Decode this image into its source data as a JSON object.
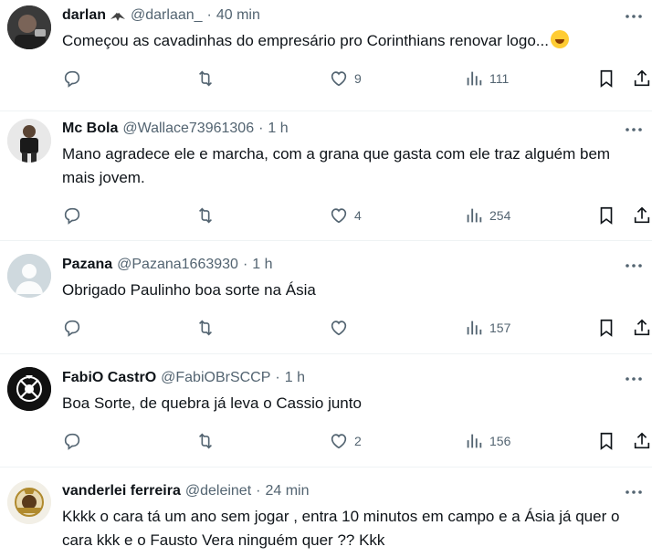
{
  "colors": {
    "text": "#0f1419",
    "muted": "#536471",
    "divider": "#eff3f4"
  },
  "icons": {
    "reply": "reply-icon",
    "retweet": "retweet-icon",
    "like": "heart-icon",
    "views": "views-icon",
    "bookmark": "bookmark-icon",
    "share": "share-icon",
    "more": "more-icon"
  },
  "tweets": [
    {
      "name": "darlan",
      "handle": "@darlaan_",
      "time": "40 min",
      "text": "Começou as cavadinhas do empresário pro Corinthians renovar logo...",
      "likes": "9",
      "views": "111"
    },
    {
      "name": "Mc Bola",
      "handle": "@Wallace73961306",
      "time": "1 h",
      "text": "Mano agradece ele e marcha, com a grana que gasta com ele traz alguém bem mais jovem.",
      "likes": "4",
      "views": "254"
    },
    {
      "name": "Pazana",
      "handle": "@Pazana1663930",
      "time": "1 h",
      "text": "Obrigado Paulinho boa sorte na Ásia",
      "likes": "",
      "views": "157"
    },
    {
      "name": "FabiO CastrO",
      "handle": "@FabiOBrSCCP",
      "time": "1 h",
      "text": "Boa Sorte, de quebra já leva o Cassio junto",
      "likes": "2",
      "views": "156"
    },
    {
      "name": "vanderlei ferreira",
      "handle": "@deleinet",
      "time": "24 min",
      "text": "Kkkk o cara tá um ano sem jogar , entra 10 minutos em campo e a Ásia já quer o cara kkk e o Fausto Vera ninguém quer ?? Kkk"
    }
  ]
}
